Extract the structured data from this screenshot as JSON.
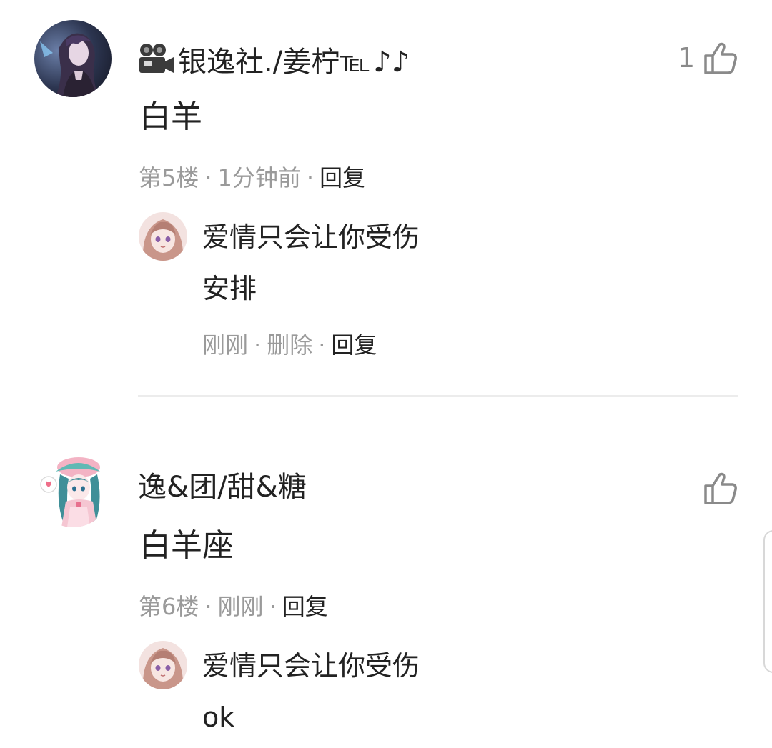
{
  "comments": [
    {
      "username": "银逸社./姜柠℡",
      "username_prefix_icon": "movie-camera-icon",
      "username_suffix": "♪♪",
      "content": "白羊",
      "floor": "第5楼",
      "time": "1分钟前",
      "reply_label": "回复",
      "like_count": "1",
      "reply": {
        "username": "爱情只会让你受伤",
        "content": "安排",
        "time": "刚刚",
        "delete_label": "删除",
        "reply_label": "回复"
      }
    },
    {
      "username": "逸&团/甜&糖",
      "content": "白羊座",
      "floor": "第6楼",
      "time": "刚刚",
      "reply_label": "回复",
      "like_count": "",
      "reply": {
        "username": "爱情只会让你受伤",
        "content": "ok"
      }
    }
  ],
  "meta_separator": "·",
  "icons": {
    "like": "thumbs-up-icon"
  },
  "colors": {
    "text": "#222222",
    "meta": "#9a9a9a",
    "like": "#8a8a8a",
    "divider": "#ececec"
  }
}
